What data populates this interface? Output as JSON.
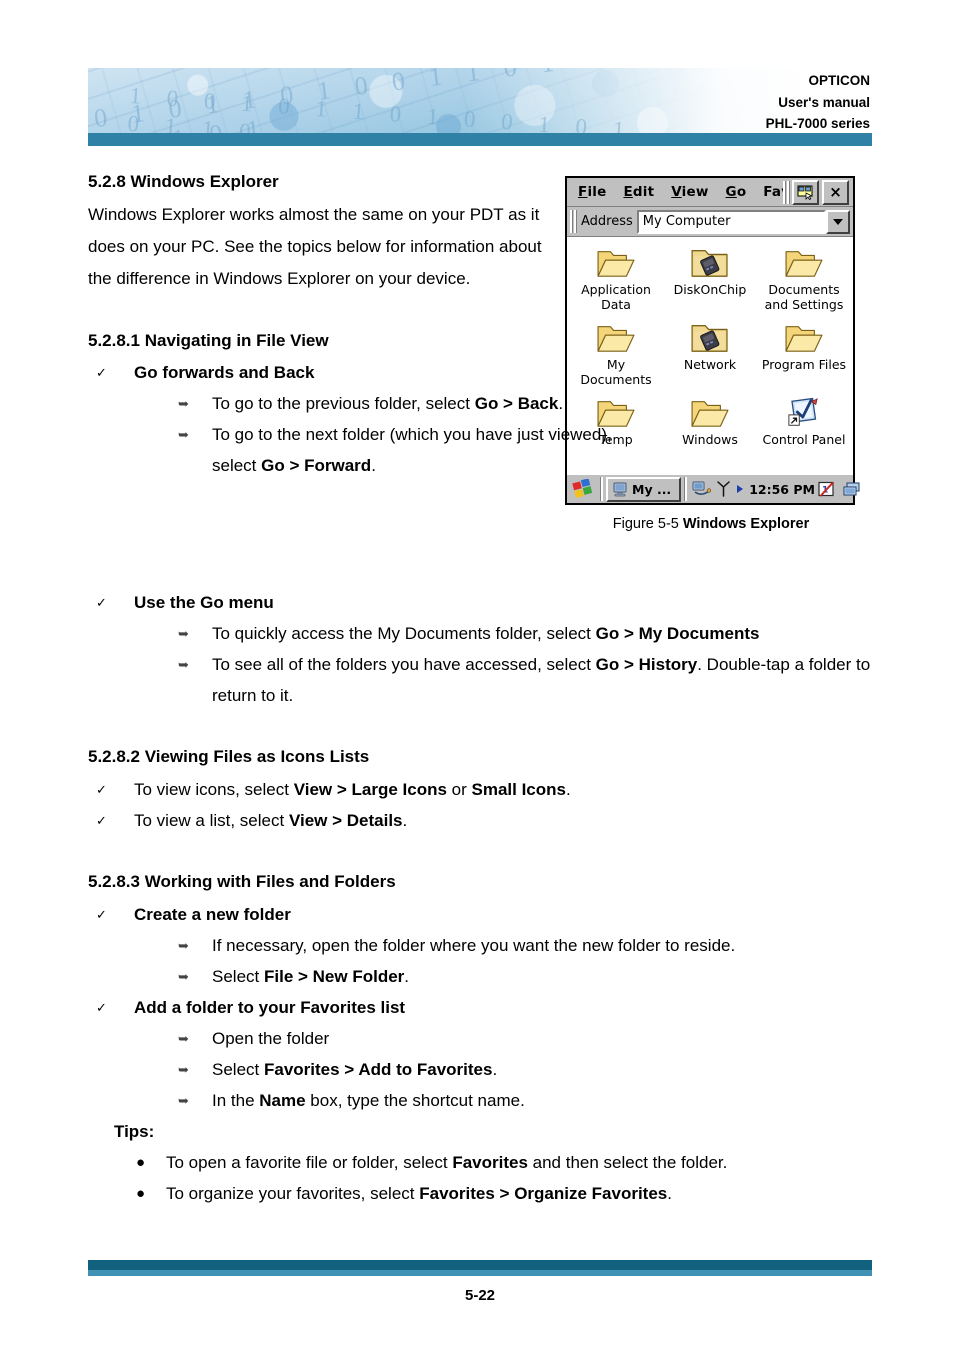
{
  "header": {
    "brand": "OPTICON",
    "doc_type": "User's manual",
    "product": "PHL-7000 series",
    "accent_bar_color": "#2f82a6"
  },
  "section": {
    "heading": "5.2.8 Windows Explorer",
    "intro": "Windows Explorer works almost the same on your PDT as it does on your PC. See the topics below for information about the difference in Windows Explorer on your device."
  },
  "sub1": {
    "heading": "5.2.8.1 Navigating in File View",
    "item1_title": "Go forwards and Back",
    "item1_sub1_pre": "To go to the previous folder, select ",
    "item1_sub1_bold": "Go > Back",
    "item1_sub1_post": ".",
    "item1_sub2_pre": "To go to the next folder (which you have just viewed), select ",
    "item1_sub2_bold": "Go > Forward",
    "item1_sub2_post": ".",
    "item2_title": "Use the Go menu",
    "item2_sub1_pre": "To quickly access the My Documents folder, select ",
    "item2_sub1_bold": "Go > My Documents",
    "item2_sub1_post": "",
    "item2_sub2_pre": "To see all of the folders you have accessed, select ",
    "item2_sub2_bold": "Go > History",
    "item2_sub2_post": ". Double-tap a folder to return to it."
  },
  "sub2": {
    "heading": "5.2.8.2 Viewing Files as Icons Lists",
    "item1_pre": "To view icons, select ",
    "item1_bold1": "View > Large Icons",
    "item1_mid": " or ",
    "item1_bold2": "Small Icons",
    "item1_post": ".",
    "item2_pre": "To view a list, select ",
    "item2_bold": "View > Details",
    "item2_post": "."
  },
  "sub3": {
    "heading": "5.2.8.3 Working with Files and Folders",
    "item1_title": "Create a new folder",
    "item1_sub1": "If necessary, open the folder where you want the new folder to reside.",
    "item1_sub2_pre": "Select ",
    "item1_sub2_bold": "File > New Folder",
    "item1_sub2_post": ".",
    "item2_title": "Add a folder to your Favorites list",
    "item2_sub1": "Open the folder",
    "item2_sub2_pre": "Select ",
    "item2_sub2_bold": "Favorites > Add to Favorites",
    "item2_sub2_post": ".",
    "item2_sub3_pre": "In the ",
    "item2_sub3_bold": "Name",
    "item2_sub3_post": " box, type the shortcut name.",
    "tips_label": "Tips:",
    "tip1_pre": "To open a favorite file or folder, select ",
    "tip1_bold": "Favorites",
    "tip1_post": " and then select the folder.",
    "tip2_pre": "To organize your favorites, select ",
    "tip2_bold": "Favorites > Organize Favorites",
    "tip2_post": "."
  },
  "figure": {
    "caption_prefix": "Figure 5-5 ",
    "caption_title": "Windows Explorer",
    "window": {
      "menus": [
        "File",
        "Edit",
        "View",
        "Go",
        "Fav"
      ],
      "close_label": "×",
      "address_label": "Address",
      "address_value": "My Computer",
      "icons": [
        {
          "label": "Application Data",
          "type": "folder"
        },
        {
          "label": "DiskOnChip",
          "type": "folder-chip"
        },
        {
          "label": "Documents and Settings",
          "type": "folder"
        },
        {
          "label": "My Documents",
          "type": "folder"
        },
        {
          "label": "Network",
          "type": "folder-chip"
        },
        {
          "label": "Program Files",
          "type": "folder"
        },
        {
          "label": "Temp",
          "type": "folder"
        },
        {
          "label": "Windows",
          "type": "folder"
        },
        {
          "label": "Control Panel",
          "type": "control-panel-shortcut"
        }
      ],
      "taskbar": {
        "start_label": "start-icon",
        "task_label": "My ...",
        "tray_time": "12:56 PM"
      }
    }
  },
  "footer": {
    "page_number": "5-22",
    "bar_dark_color": "#12617f",
    "bar_light_color": "#3e93b4"
  }
}
